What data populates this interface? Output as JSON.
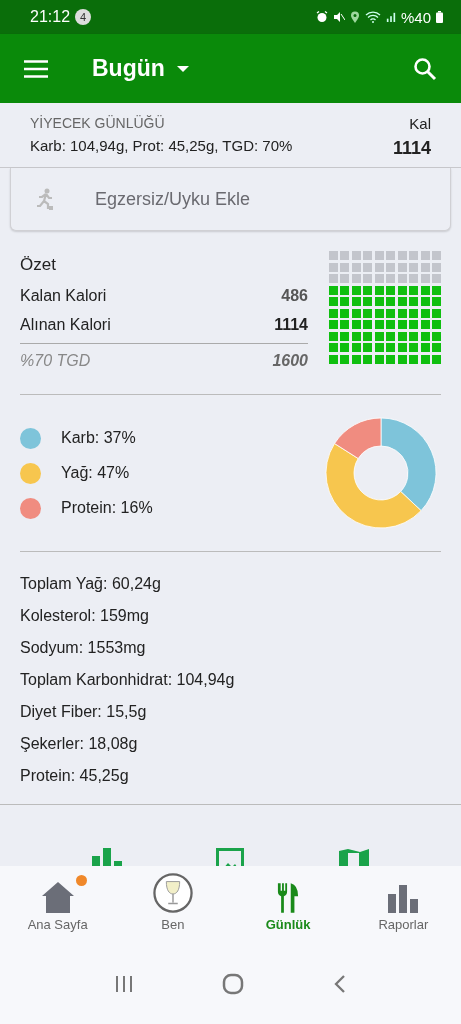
{
  "status_bar": {
    "time": "21:12",
    "notification_count": "4",
    "battery": "%40"
  },
  "app_bar": {
    "title": "Bugün"
  },
  "food_log": {
    "heading": "YİYECEK GÜNLÜĞÜ",
    "summary": "Karb: 104,94g, Prot: 45,25g, TGD: 70%",
    "unit": "Kal",
    "calories": "1114"
  },
  "exercise_button": {
    "label": "Egzersiz/Uyku Ekle"
  },
  "summary": {
    "title": "Özet",
    "rows": [
      {
        "label": "Kalan Kalori",
        "value": "486",
        "kind": "remaining"
      },
      {
        "label": "Alınan Kalori",
        "value": "1114",
        "kind": "consumed"
      },
      {
        "label": "%70 TGD",
        "value": "1600",
        "kind": "target"
      }
    ],
    "grid": {
      "kind": "waffle"
    }
  },
  "macros": {
    "legend": [
      {
        "label": "Karb: 37%",
        "color": "#7ec4da"
      },
      {
        "label": "Yağ: 47%",
        "color": "#f7c64e"
      },
      {
        "label": "Protein: 16%",
        "color": "#f08c80"
      }
    ],
    "chart_data": {
      "type": "donut",
      "values": [
        37,
        47,
        16
      ]
    }
  },
  "nutrients": [
    "Toplam Yağ: 60,24g",
    "Kolesterol: 159mg",
    "Sodyum: 1553mg",
    "Toplam Karbonhidrat: 104,94g",
    "Diyet Fiber: 15,5g",
    "Şekerler: 18,08g",
    "Protein: 45,25g"
  ],
  "shortcuts": [
    {
      "kind": "chart"
    },
    {
      "kind": "image"
    },
    {
      "kind": "map"
    }
  ],
  "bottom_nav": [
    {
      "label": "Ana Sayfa",
      "kind": "home",
      "selected": false,
      "badge": true
    },
    {
      "label": "Ben",
      "kind": "avatar",
      "selected": false,
      "badge": false
    },
    {
      "label": "Günlük",
      "kind": "diary",
      "selected": true,
      "badge": false
    },
    {
      "label": "Raporlar",
      "kind": "reports",
      "selected": false,
      "badge": false
    }
  ]
}
